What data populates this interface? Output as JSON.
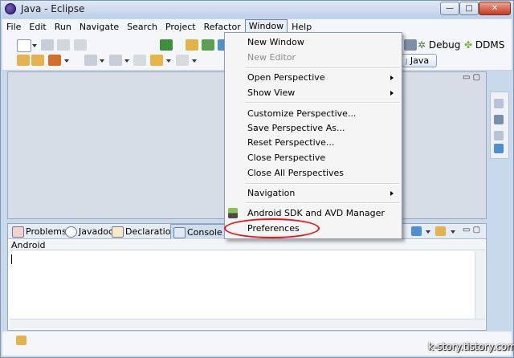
{
  "window": {
    "title": "Java - Eclipse",
    "controls": {
      "minimize": "—",
      "maximize": "□",
      "close": "✕"
    }
  },
  "menubar": [
    "File",
    "Edit",
    "Run",
    "Navigate",
    "Search",
    "Project",
    "Refactor",
    "Window",
    "Help"
  ],
  "perspectives": {
    "debug": "Debug",
    "ddms": "DDMS",
    "java": "Java"
  },
  "window_menu": {
    "new_window": "New Window",
    "new_editor": "New Editor",
    "open_perspective": "Open Perspective",
    "show_view": "Show View",
    "customize_perspective": "Customize Perspective...",
    "save_perspective_as": "Save Perspective As...",
    "reset_perspective": "Reset Perspective...",
    "close_perspective": "Close Perspective",
    "close_all_perspectives": "Close All Perspectives",
    "navigation": "Navigation",
    "android_sdk_avd_manager": "Android SDK and AVD Manager",
    "preferences": "Preferences"
  },
  "bottom_tabs": {
    "problems": "Problems",
    "javadoc": "Javadoc",
    "declaration": "Declaration",
    "console": "Console"
  },
  "console": {
    "label": "Android",
    "content": ""
  },
  "editor_controls": "▭ ▢",
  "watermark": "k-story.tistory.com",
  "colors": {
    "highlight_ellipse": "#e3161c",
    "active_tab": "#cfdcee",
    "menu_bg": "#f5f5f5"
  },
  "icons": [
    "new-wizard-icon",
    "save-icon",
    "print-icon",
    "run-icon",
    "debug-icon",
    "new-package-icon",
    "back-icon",
    "forward-icon",
    "android-icon",
    "problems-icon",
    "javadoc-icon",
    "declaration-icon",
    "console-icon"
  ]
}
